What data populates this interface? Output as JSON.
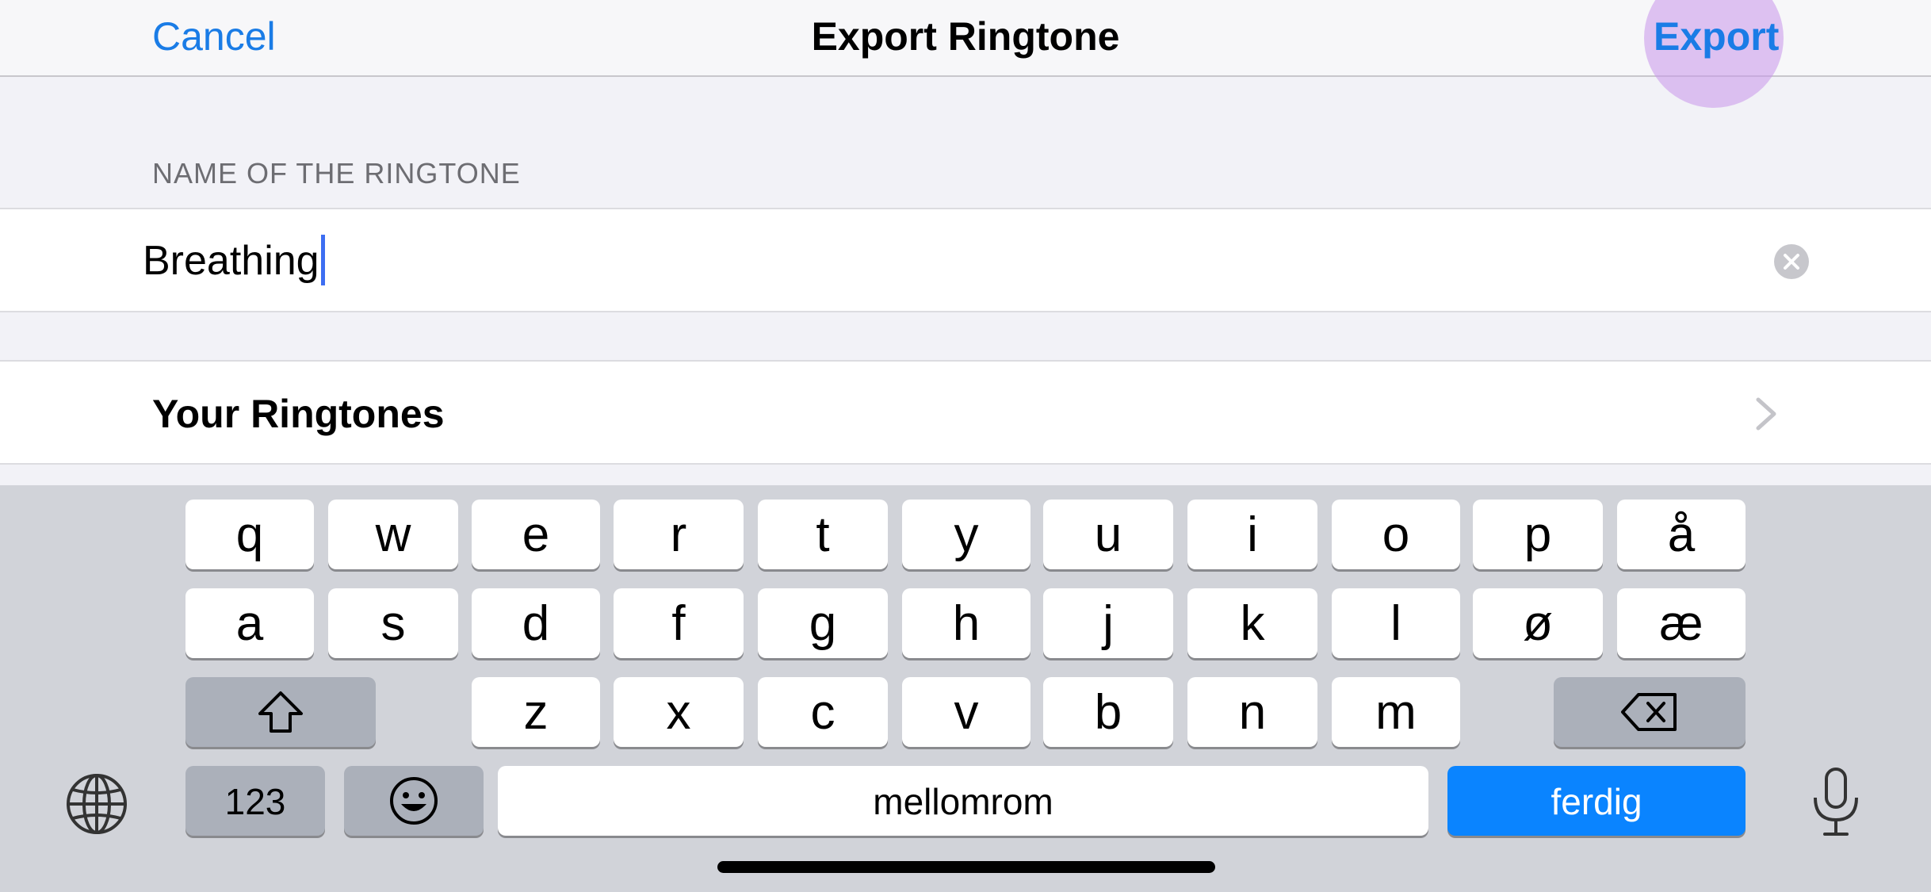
{
  "navbar": {
    "cancel_label": "Cancel",
    "title": "Export Ringtone",
    "export_label": "Export"
  },
  "form": {
    "section_header": "NAME OF THE RINGTONE",
    "name_value": "Breathing",
    "clear_icon": "clear-icon"
  },
  "list": {
    "your_ringtones_label": "Your Ringtones",
    "chevron_icon": "chevron-right-icon"
  },
  "keyboard": {
    "row1": [
      "q",
      "w",
      "e",
      "r",
      "t",
      "y",
      "u",
      "i",
      "o",
      "p",
      "å"
    ],
    "row2": [
      "a",
      "s",
      "d",
      "f",
      "g",
      "h",
      "j",
      "k",
      "l",
      "ø",
      "æ"
    ],
    "row3": [
      "z",
      "x",
      "c",
      "v",
      "b",
      "n",
      "m"
    ],
    "numbers_label": "123",
    "space_label": "mellomrom",
    "done_label": "ferdig",
    "shift_icon": "shift-icon",
    "delete_icon": "backspace-icon",
    "emoji_icon": "emoji-icon",
    "globe_icon": "globe-icon",
    "mic_icon": "microphone-icon"
  },
  "colors": {
    "accent": "#1a7ce6",
    "done_key": "#0a84ff",
    "highlight": "#c896eb"
  }
}
